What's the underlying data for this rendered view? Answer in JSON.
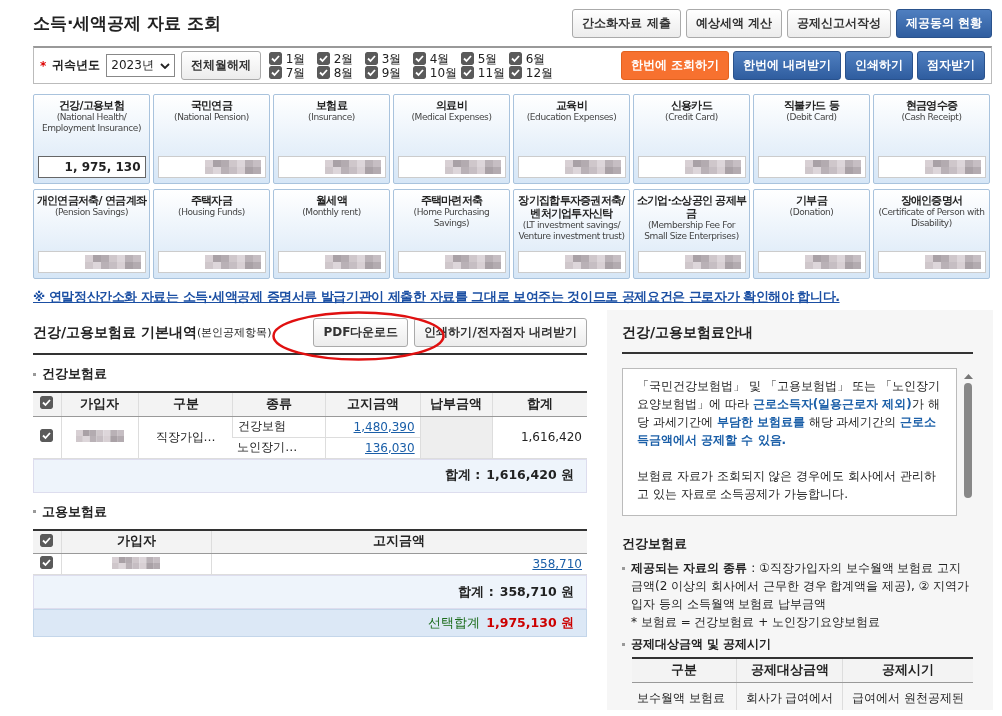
{
  "title": "소득·세액공제 자료 조회",
  "top_buttons": [
    {
      "label": "간소화자료 제출",
      "kind": "default"
    },
    {
      "label": "예상세액 계산",
      "kind": "default"
    },
    {
      "label": "공제신고서작성",
      "kind": "default"
    },
    {
      "label": "제공동의 현황",
      "kind": "primary"
    }
  ],
  "filter": {
    "required_mark": "*",
    "year_label": "귀속년도",
    "year": "2023년",
    "clear_button": "전체월해제",
    "months": [
      {
        "label": "1월",
        "checked": true
      },
      {
        "label": "2월",
        "checked": true
      },
      {
        "label": "3월",
        "checked": true
      },
      {
        "label": "4월",
        "checked": true
      },
      {
        "label": "5월",
        "checked": true
      },
      {
        "label": "6월",
        "checked": true
      },
      {
        "label": "7월",
        "checked": true
      },
      {
        "label": "8월",
        "checked": true
      },
      {
        "label": "9월",
        "checked": true
      },
      {
        "label": "10월",
        "checked": true
      },
      {
        "label": "11월",
        "checked": true
      },
      {
        "label": "12월",
        "checked": true
      }
    ],
    "buttons": [
      {
        "label": "한번에 조회하기",
        "kind": "accent"
      },
      {
        "label": "한번에 내려받기",
        "kind": "primary"
      },
      {
        "label": "인쇄하기",
        "kind": "primary"
      },
      {
        "label": "점자받기",
        "kind": "primary"
      }
    ]
  },
  "cards": [
    {
      "title": "건강/고용보험",
      "subtitle": "(National Health/ Employment Insurance)",
      "value": "1, 975, 130",
      "redacted": false
    },
    {
      "title": "국민연금",
      "subtitle": "(National Pension)",
      "redacted": true
    },
    {
      "title": "보험료",
      "subtitle": "(Insurance)",
      "redacted": true
    },
    {
      "title": "의료비",
      "subtitle": "(Medical Expenses)",
      "redacted": true
    },
    {
      "title": "교육비",
      "subtitle": "(Education Expenses)",
      "redacted": true
    },
    {
      "title": "신용카드",
      "subtitle": "(Credit Card)",
      "redacted": true
    },
    {
      "title": "직불카드 등",
      "subtitle": "(Debit Card)",
      "redacted": true
    },
    {
      "title": "현금영수증",
      "subtitle": "(Cash Receipt)",
      "redacted": true
    },
    {
      "title": "개인연금저축/ 연금계좌",
      "subtitle": "(Pension Savings)",
      "redacted": true
    },
    {
      "title": "주택자금",
      "subtitle": "(Housing Funds)",
      "redacted": true
    },
    {
      "title": "월세액",
      "subtitle": "(Monthly rent)",
      "redacted": true
    },
    {
      "title": "주택마련저축",
      "subtitle": "(Home Purchasing Savings)",
      "redacted": true
    },
    {
      "title": "장기집합투자증권저축/ 벤처기업투자신탁",
      "subtitle": "(LT investment savings/ Venture investment trust)",
      "redacted": true
    },
    {
      "title": "소기업·소상공인 공제부금",
      "subtitle": "(Membership Fee For Small Size Enterprises)",
      "redacted": true
    },
    {
      "title": "기부금",
      "subtitle": "(Donation)",
      "redacted": true
    },
    {
      "title": "장애인증명서",
      "subtitle": "(Certificate of Person with Disability)",
      "redacted": true
    }
  ],
  "notice": "※ 연말정산간소화 자료는 소득·세액공제 증명서류 발급기관이 제출한 자료를 그대로 보여주는 것이므로 공제요건은 근로자가 확인해야 합니다.",
  "detail": {
    "title": "건강/고용보험료 기본내역",
    "title_note": "(본인공제항목)",
    "buttons": [
      "PDF다운로드",
      "인쇄하기/전자점자 내려받기"
    ],
    "highlight": {
      "kind": "ellipse"
    },
    "health": {
      "heading": "건강보험료",
      "columns": [
        "가입자",
        "구분",
        "종류",
        "고지금액",
        "납부금액",
        "합계"
      ],
      "all_checked": true,
      "rows": [
        {
          "checked": true,
          "subscriber_redacted": true,
          "category": "직장가입…",
          "items": [
            {
              "type": "건강보험",
              "amount": "1,480,390"
            },
            {
              "type": "노인장기…",
              "amount": "136,030"
            }
          ],
          "total": "1,616,420"
        }
      ],
      "sum_label": "합계 :",
      "sum": "1,616,420 원"
    },
    "employment": {
      "heading": "고용보험료",
      "columns": [
        "가입자",
        "고지금액"
      ],
      "all_checked": true,
      "rows": [
        {
          "checked": true,
          "subscriber_redacted": true,
          "amount": "358,710"
        }
      ],
      "sum_label": "합계 :",
      "sum": "358,710 원"
    },
    "selected_total_label": "선택합계",
    "selected_total": "1,975,130 원"
  },
  "guide": {
    "title": "건강/고용보험료안내",
    "box": [
      "「국민건강보험법」 및 「고용보험법」 또는 「노인장기요양보험법」에 따라 **근로소득자(일용근로자 제외)**가 해당 과세기간에 **부담한 보험료를** 해당 과세기간의 **근로소득금액에서 공제할 수 있음.**",
      "보험료 자료가 조회되지 않은 경우에도 회사에서 관리하고 있는 자료로 소득공제가 가능합니다."
    ],
    "section": "건강보험료",
    "bullets": [
      {
        "text": "**제공되는 자료의 종류** : ①직장가입자의 보수월액 보험료 고지금액(2 이상의 회사에서 근무한 경우 합계액을 제공), ② 지역가입자 등의 소득월액 보험료 납부금액",
        "note": "* 보험료 = 건강보험료 + 노인장기요양보험료"
      },
      {
        "text": "**공제대상금액 및 공제시기**"
      }
    ],
    "table": {
      "columns": [
        "구분",
        "공제대상금액",
        "공제시기"
      ],
      "rows": [
        [
          "보수월액 보험료",
          "회사가 급여에서",
          "급여에서 원천공제된"
        ]
      ]
    }
  }
}
